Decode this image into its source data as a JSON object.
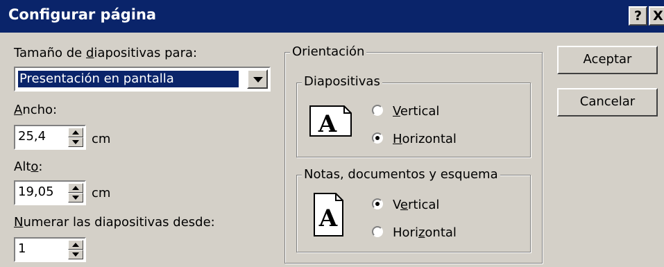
{
  "dialog": {
    "title": "Configurar página",
    "help_glyph": "?",
    "close_glyph": "X"
  },
  "size": {
    "label_pre": "Tamaño de ",
    "label_u": "d",
    "label_post": "iapositivas para:",
    "selected": "Presentación en pantalla"
  },
  "width": {
    "label_u": "A",
    "label_post": "ncho:",
    "value": "25,4",
    "unit": "cm"
  },
  "height": {
    "label_pre": "Alt",
    "label_u": "o",
    "label_post": ":",
    "value": "19,05",
    "unit": "cm"
  },
  "numbering": {
    "label_u": "N",
    "label_post": "umerar las diapositivas desde:",
    "value": "1"
  },
  "orientation": {
    "label": "Orientación",
    "slides": {
      "label": "Diapositivas",
      "vertical_u": "V",
      "vertical_post": "ertical",
      "horizontal_u": "H",
      "horizontal_post": "orizontal",
      "selected": "horizontal",
      "icon_letter": "A"
    },
    "notes": {
      "label": "Notas, documentos y esquema",
      "vertical_pre": "V",
      "vertical_u": "e",
      "vertical_post": "rtical",
      "horizontal_pre": "Hori",
      "horizontal_u": "z",
      "horizontal_post": "ontal",
      "selected": "vertical",
      "icon_letter": "A"
    }
  },
  "buttons": {
    "ok": "Aceptar",
    "cancel": "Cancelar"
  }
}
